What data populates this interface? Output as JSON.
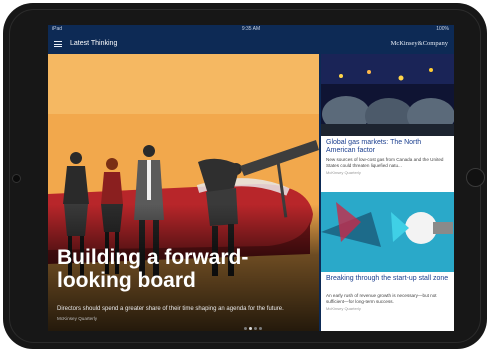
{
  "status": {
    "carrier": "iPad",
    "time": "9:35 AM",
    "battery": "100%"
  },
  "appbar": {
    "title": "Latest Thinking",
    "brand": "McKinsey&Company",
    "menu_icon": "hamburger-menu-icon"
  },
  "hero": {
    "title": "Building a forward-looking board",
    "dek": "Directors should spend a greater share of their time shaping an agenda for the future.",
    "source": "McKinsey Quarterly",
    "pager": {
      "count": 4,
      "active": 1
    }
  },
  "cards": [
    {
      "title": "Global gas markets: The North American factor",
      "dek": "New sources of low-cost gas from Canada and the United States could threaten liquefied natu...",
      "source": "McKinsey Quarterly"
    },
    {
      "title": "Breaking through the start-up stall zone",
      "dek": "An early rush of revenue growth is necessary—but not sufficient—for long-term success.",
      "source": "McKinsey Quarterly"
    }
  ],
  "colors": {
    "navy": "#0d2a55",
    "card_title": "#1b3f8f",
    "hero_bg": "#f2a84c"
  }
}
